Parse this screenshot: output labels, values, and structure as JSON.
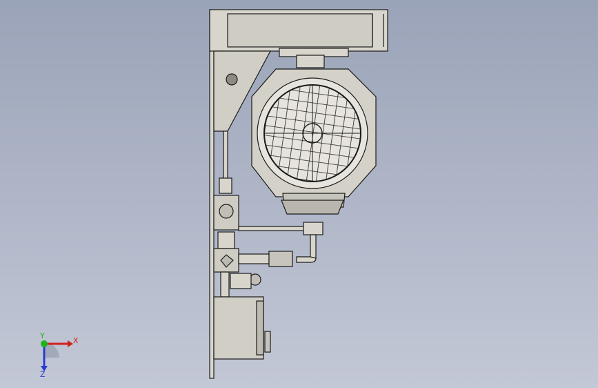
{
  "viewport": {
    "background_top": "#9aa3b8",
    "background_bottom": "#c3c8d6",
    "part_fill": "#d8d6cc",
    "part_shade": "#b9b7ad",
    "line_color": "#1a1a1a"
  },
  "triad": {
    "x_label": "X",
    "y_label": "Y",
    "z_label": "Z",
    "x_color": "#d11f1f",
    "y_color": "#1fb31f",
    "z_color": "#2a3bd1"
  }
}
